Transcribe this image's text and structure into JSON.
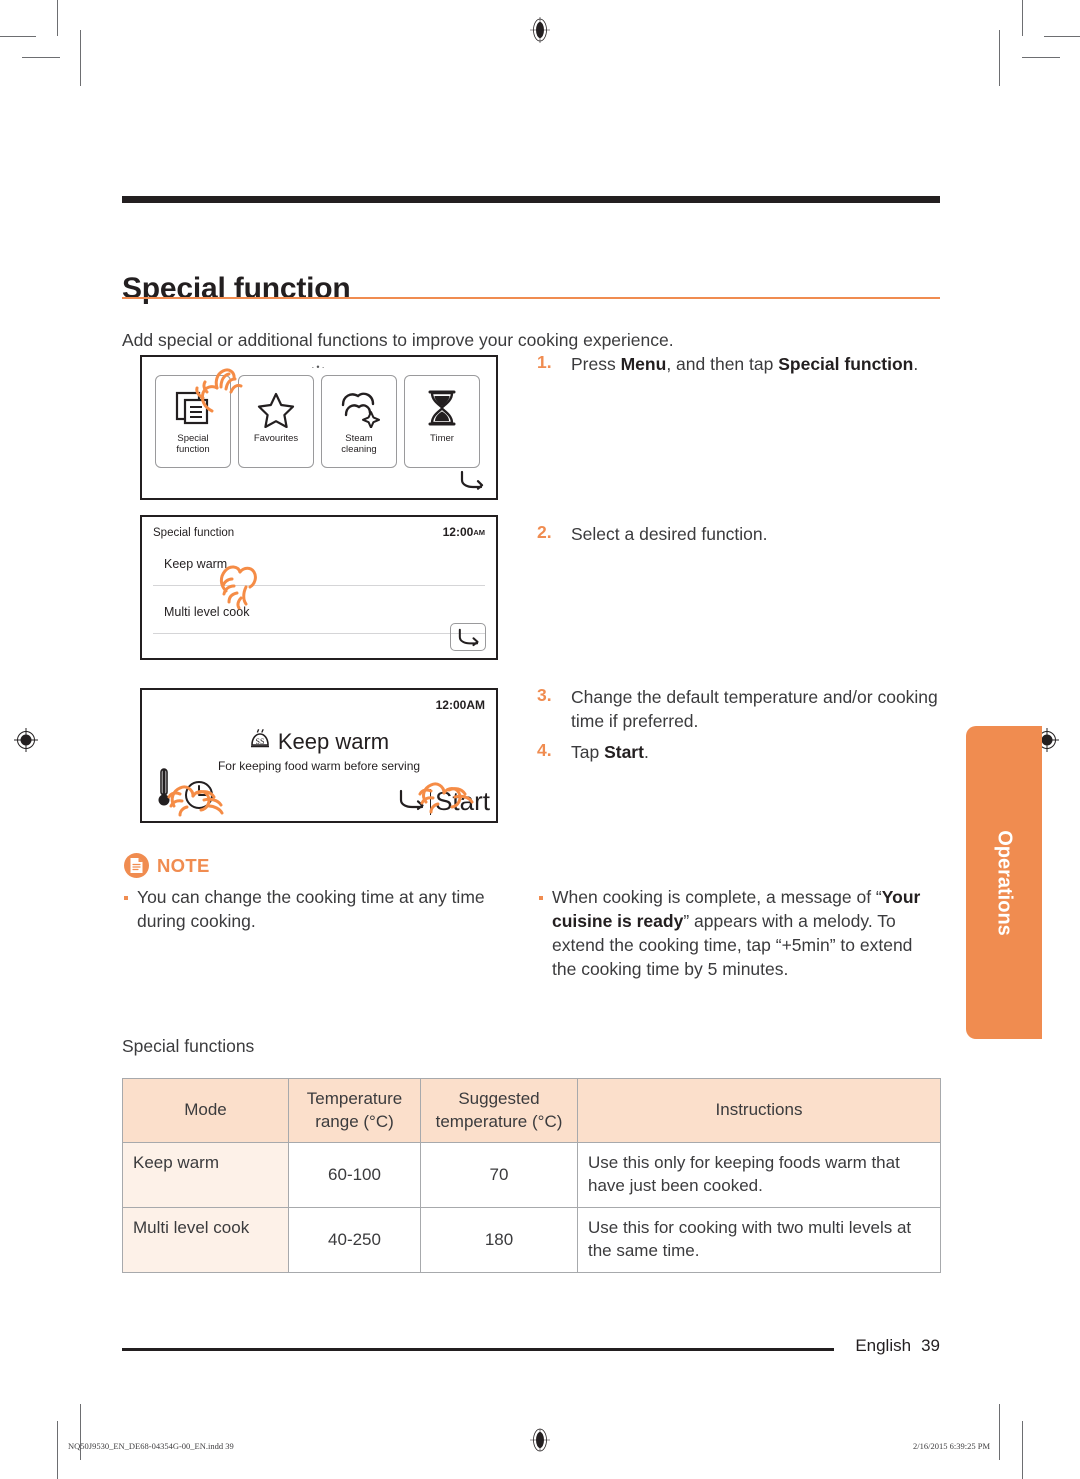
{
  "page": {
    "title": "Special function",
    "intro": "Add special or additional functions to improve your cooking experience.",
    "side_tab": "Operations",
    "footer_language": "English",
    "footer_page": "39",
    "accent_color": "#f08c50",
    "ink_color": "#231f20"
  },
  "panel_menu": {
    "dots": "·•·",
    "tiles": [
      {
        "label_line1": "Special",
        "label_line2": "function",
        "icon": "documents-icon"
      },
      {
        "label_line1": "Favourites",
        "label_line2": "",
        "icon": "star-icon"
      },
      {
        "label_line1": "Steam",
        "label_line2": "cleaning",
        "icon": "steam-icon"
      },
      {
        "label_line1": "Timer",
        "label_line2": "",
        "icon": "hourglass-icon"
      }
    ],
    "back_icon": "back-arrow-icon"
  },
  "panel_list": {
    "header_title": "Special function",
    "clock_time": "12:00",
    "clock_ampm": "AM",
    "items": [
      "Keep warm",
      "Multi level cook"
    ],
    "back_icon": "back-arrow-icon"
  },
  "panel_detail": {
    "clock_time": "12:00",
    "clock_ampm": "AM",
    "mode_title": "Keep warm",
    "mode_icon": "keep-warm-icon",
    "description": "For keeping food warm before serving",
    "temperature_icon": "thermometer-icon",
    "time_icon": "clock-icon",
    "back_icon": "back-arrow-icon",
    "start_label": "Start"
  },
  "steps": [
    {
      "num": "1.",
      "html": "Press <b>Menu</b>, and then tap <b>Special function</b>."
    },
    {
      "num": "2.",
      "html": "Select a desired function."
    },
    {
      "num": "3.",
      "html": "Change the default temperature and/or cooking time if preferred."
    },
    {
      "num": "4.",
      "html": "Tap <b>Start</b>."
    }
  ],
  "note": {
    "label": "NOTE",
    "icon": "note-document-icon",
    "bullets_left": [
      "You can change the cooking time at any time during cooking."
    ],
    "bullets_right": [
      "When cooking is complete, a message of “<b>Your cuisine is ready</b>” appears with a melody. To extend the cooking time, tap “+5min” to extend the cooking time by 5 minutes."
    ]
  },
  "table": {
    "caption": "Special functions",
    "headers": [
      "Mode",
      "Temperature range (°C)",
      "Suggested temperature (°C)",
      "Instructions"
    ],
    "header_lines": [
      [
        "Mode",
        ""
      ],
      [
        "Temperature",
        "range (°C)"
      ],
      [
        "Suggested",
        "temperature (°C)"
      ],
      [
        "Instructions",
        ""
      ]
    ],
    "rows": [
      {
        "mode": "Keep warm",
        "range": "60-100",
        "suggested": "70",
        "instructions": "Use this only for keeping foods warm that have just been cooked."
      },
      {
        "mode": "Multi level cook",
        "range": "40-250",
        "suggested": "180",
        "instructions": "Use this for cooking with two multi levels at the same time."
      }
    ],
    "header_bg": "#fbdfcb",
    "mode_cell_bg": "#fdf1e8"
  },
  "print_slug": {
    "filename": "NQ50J9530_EN_DE68-04354G-00_EN.indd   39",
    "timestamp": "2/16/2015   6:39:25 PM"
  }
}
